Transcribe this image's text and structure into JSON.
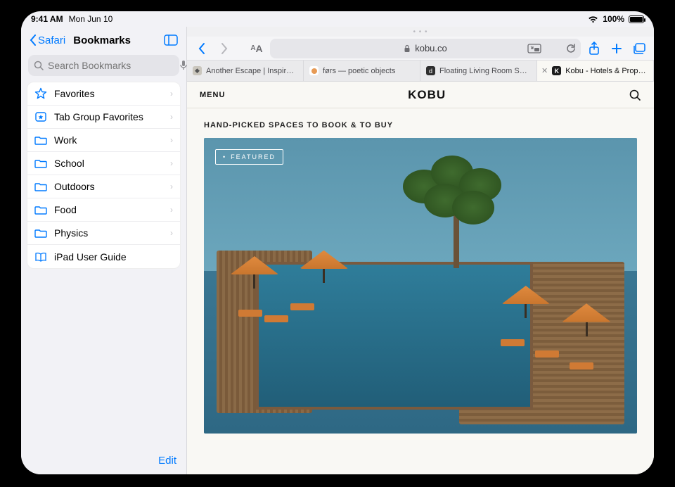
{
  "status": {
    "time": "9:41 AM",
    "date": "Mon Jun 10",
    "battery_pct": "100%"
  },
  "sidebar": {
    "back_label": "Safari",
    "title": "Bookmarks",
    "search_placeholder": "Search Bookmarks",
    "items": [
      {
        "icon": "star",
        "label": "Favorites",
        "disclose": true
      },
      {
        "icon": "tabstar",
        "label": "Tab Group Favorites",
        "disclose": true
      },
      {
        "icon": "folder",
        "label": "Work",
        "disclose": true
      },
      {
        "icon": "folder",
        "label": "School",
        "disclose": true
      },
      {
        "icon": "folder",
        "label": "Outdoors",
        "disclose": true
      },
      {
        "icon": "folder",
        "label": "Food",
        "disclose": true
      },
      {
        "icon": "folder",
        "label": "Physics",
        "disclose": true
      },
      {
        "icon": "book",
        "label": "iPad User Guide",
        "disclose": false
      }
    ],
    "edit_label": "Edit"
  },
  "browser": {
    "url_display": "kobu.co",
    "tabs": [
      {
        "label": "Another Escape | Inspir…",
        "active": false,
        "fav_color": "#cac6bd"
      },
      {
        "label": "førs — poetic objects",
        "active": false,
        "fav_color": "#e79a55"
      },
      {
        "label": "Floating Living Room Se…",
        "active": false,
        "fav_color": "#2f2f2f"
      },
      {
        "label": "Kobu - Hotels & Propert…",
        "active": true,
        "fav_color": "#1c1c1c"
      }
    ]
  },
  "page": {
    "menu_label": "MENU",
    "logo_text": "KOBU",
    "tagline": "HAND-PICKED SPACES TO BOOK & TO BUY",
    "featured_badge": "FEATURED"
  }
}
